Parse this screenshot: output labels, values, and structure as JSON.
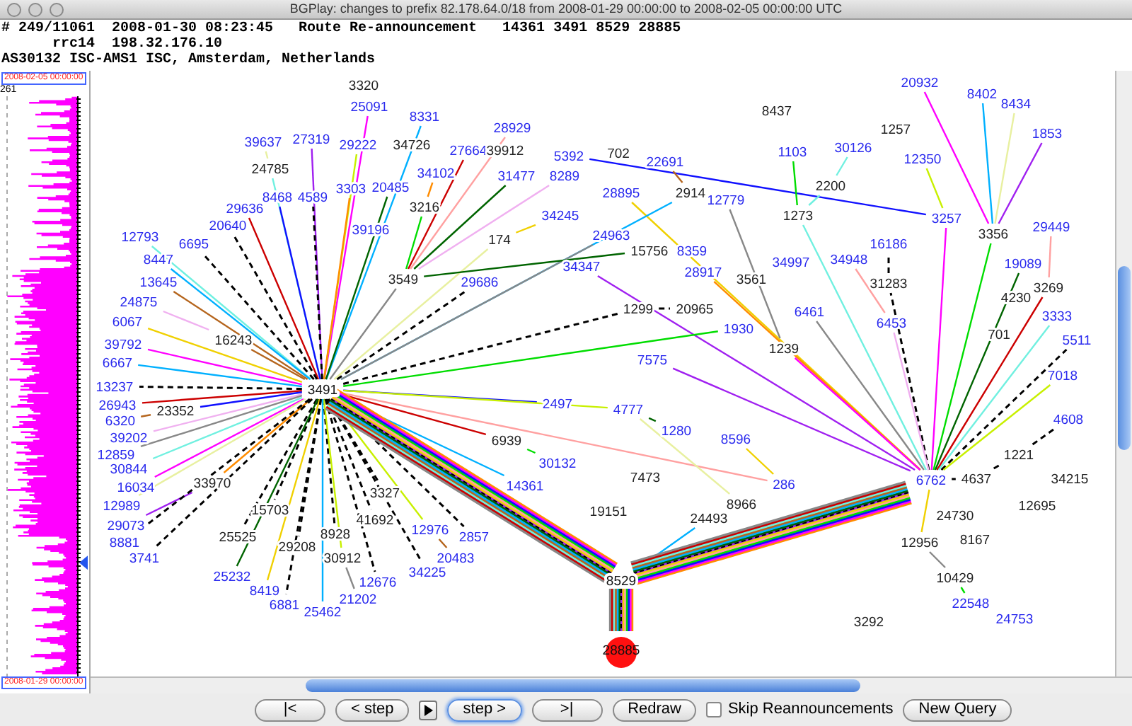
{
  "window": {
    "title": "BGPlay: changes to prefix 82.178.64.0/18 from 2008-01-29 00:00:00 to 2008-02-05 00:00:00 UTC"
  },
  "event": {
    "lines": [
      "# 249/11061  2008-01-30 08:23:45   Route Re-announcement   14361 3491 8529 28885",
      "      rrc14  198.32.176.10",
      "AS30132 ISC-AMS1 ISC, Amsterdam, Netherlands"
    ]
  },
  "timeline": {
    "end_label": "2008-02-05 00:00:00",
    "max_count": "261",
    "start_label": "2008-01-29 00:00:00",
    "cursor": {
      "level": 0.19
    }
  },
  "graph": {
    "nodes": [
      {
        "label": "3320",
        "kind": "transit"
      },
      {
        "label": "20932",
        "kind": "origin"
      },
      {
        "label": "8402",
        "kind": "origin"
      },
      {
        "label": "25091",
        "kind": "origin"
      },
      {
        "label": "8437",
        "kind": "transit"
      },
      {
        "label": "8434",
        "kind": "origin"
      },
      {
        "label": "8331",
        "kind": "origin"
      },
      {
        "label": "28929",
        "kind": "origin"
      },
      {
        "label": "1257",
        "kind": "transit"
      },
      {
        "label": "1853",
        "kind": "origin"
      },
      {
        "label": "39637",
        "kind": "origin"
      },
      {
        "label": "27319",
        "kind": "origin"
      },
      {
        "label": "29222",
        "kind": "origin"
      },
      {
        "label": "34726",
        "kind": "transit"
      },
      {
        "label": "27664",
        "kind": "origin"
      },
      {
        "label": "39912",
        "kind": "transit"
      },
      {
        "label": "5392",
        "kind": "origin"
      },
      {
        "label": "702",
        "kind": "transit"
      },
      {
        "label": "22691",
        "kind": "origin"
      },
      {
        "label": "1103",
        "kind": "origin"
      },
      {
        "label": "30126",
        "kind": "origin"
      },
      {
        "label": "12350",
        "kind": "origin"
      },
      {
        "label": "24785",
        "kind": "transit"
      },
      {
        "label": "34102",
        "kind": "origin"
      },
      {
        "label": "31477",
        "kind": "origin"
      },
      {
        "label": "8289",
        "kind": "origin"
      },
      {
        "label": "8468",
        "kind": "origin"
      },
      {
        "label": "4589",
        "kind": "origin"
      },
      {
        "label": "3303",
        "kind": "origin"
      },
      {
        "label": "20485",
        "kind": "origin"
      },
      {
        "label": "28895",
        "kind": "origin"
      },
      {
        "label": "2914",
        "kind": "transit"
      },
      {
        "label": "12779",
        "kind": "origin"
      },
      {
        "label": "2200",
        "kind": "transit"
      },
      {
        "label": "29636",
        "kind": "origin"
      },
      {
        "label": "3216",
        "kind": "transit"
      },
      {
        "label": "34245",
        "kind": "origin"
      },
      {
        "label": "1273",
        "kind": "transit"
      },
      {
        "label": "3257",
        "kind": "origin"
      },
      {
        "label": "12793",
        "kind": "origin"
      },
      {
        "label": "20640",
        "kind": "origin"
      },
      {
        "label": "39196",
        "kind": "origin"
      },
      {
        "label": "174",
        "kind": "transit"
      },
      {
        "label": "24963",
        "kind": "origin"
      },
      {
        "label": "3356",
        "kind": "transit"
      },
      {
        "label": "29449",
        "kind": "origin"
      },
      {
        "label": "6695",
        "kind": "origin"
      },
      {
        "label": "15756",
        "kind": "transit"
      },
      {
        "label": "8359",
        "kind": "origin"
      },
      {
        "label": "16186",
        "kind": "origin"
      },
      {
        "label": "8447",
        "kind": "origin"
      },
      {
        "label": "34347",
        "kind": "origin"
      },
      {
        "label": "34997",
        "kind": "origin"
      },
      {
        "label": "34948",
        "kind": "origin"
      },
      {
        "label": "19089",
        "kind": "origin"
      },
      {
        "label": "13645",
        "kind": "origin"
      },
      {
        "label": "3549",
        "kind": "transit"
      },
      {
        "label": "29686",
        "kind": "origin"
      },
      {
        "label": "28917",
        "kind": "origin"
      },
      {
        "label": "3561",
        "kind": "transit"
      },
      {
        "label": "31283",
        "kind": "transit"
      },
      {
        "label": "3269",
        "kind": "transit"
      },
      {
        "label": "24875",
        "kind": "origin"
      },
      {
        "label": "4230",
        "kind": "transit"
      },
      {
        "label": "6067",
        "kind": "origin"
      },
      {
        "label": "1299",
        "kind": "transit"
      },
      {
        "label": "20965",
        "kind": "transit"
      },
      {
        "label": "1930",
        "kind": "origin"
      },
      {
        "label": "6461",
        "kind": "origin"
      },
      {
        "label": "6453",
        "kind": "origin"
      },
      {
        "label": "701",
        "kind": "transit"
      },
      {
        "label": "3333",
        "kind": "origin"
      },
      {
        "label": "39792",
        "kind": "origin"
      },
      {
        "label": "16243",
        "kind": "transit"
      },
      {
        "label": "1239",
        "kind": "transit"
      },
      {
        "label": "5511",
        "kind": "origin"
      },
      {
        "label": "6667",
        "kind": "origin"
      },
      {
        "label": "7575",
        "kind": "origin"
      },
      {
        "label": "7018",
        "kind": "origin"
      },
      {
        "label": "13237",
        "kind": "origin"
      },
      {
        "label": "3491",
        "kind": "hub"
      },
      {
        "label": "26943",
        "kind": "origin"
      },
      {
        "label": "23352",
        "kind": "transit"
      },
      {
        "label": "2497",
        "kind": "origin"
      },
      {
        "label": "4777",
        "kind": "origin"
      },
      {
        "label": "6320",
        "kind": "origin"
      },
      {
        "label": "4608",
        "kind": "origin"
      },
      {
        "label": "39202",
        "kind": "origin"
      },
      {
        "label": "6939",
        "kind": "transit"
      },
      {
        "label": "1280",
        "kind": "origin"
      },
      {
        "label": "8596",
        "kind": "origin"
      },
      {
        "label": "12859",
        "kind": "origin"
      },
      {
        "label": "1221",
        "kind": "transit"
      },
      {
        "label": "30844",
        "kind": "origin"
      },
      {
        "label": "30132",
        "kind": "origin"
      },
      {
        "label": "16034",
        "kind": "origin"
      },
      {
        "label": "33970",
        "kind": "transit"
      },
      {
        "label": "3327",
        "kind": "transit"
      },
      {
        "label": "14361",
        "kind": "origin"
      },
      {
        "label": "7473",
        "kind": "transit"
      },
      {
        "label": "286",
        "kind": "origin"
      },
      {
        "label": "6762",
        "kind": "hub-origin"
      },
      {
        "label": "4637",
        "kind": "transit"
      },
      {
        "label": "34215",
        "kind": "transit"
      },
      {
        "label": "12989",
        "kind": "origin"
      },
      {
        "label": "15703",
        "kind": "transit"
      },
      {
        "label": "41692",
        "kind": "transit"
      },
      {
        "label": "19151",
        "kind": "transit"
      },
      {
        "label": "24493",
        "kind": "transit"
      },
      {
        "label": "8966",
        "kind": "transit"
      },
      {
        "label": "24730",
        "kind": "transit"
      },
      {
        "label": "12695",
        "kind": "transit"
      },
      {
        "label": "29073",
        "kind": "origin"
      },
      {
        "label": "8881",
        "kind": "origin"
      },
      {
        "label": "25525",
        "kind": "transit"
      },
      {
        "label": "29208",
        "kind": "transit"
      },
      {
        "label": "8928",
        "kind": "transit"
      },
      {
        "label": "12976",
        "kind": "origin"
      },
      {
        "label": "2857",
        "kind": "origin"
      },
      {
        "label": "12956",
        "kind": "transit"
      },
      {
        "label": "8167",
        "kind": "transit"
      },
      {
        "label": "3741",
        "kind": "origin"
      },
      {
        "label": "30912",
        "kind": "transit"
      },
      {
        "label": "20483",
        "kind": "origin"
      },
      {
        "label": "25232",
        "kind": "origin"
      },
      {
        "label": "12676",
        "kind": "origin"
      },
      {
        "label": "34225",
        "kind": "origin"
      },
      {
        "label": "8529",
        "kind": "hub"
      },
      {
        "label": "10429",
        "kind": "transit"
      },
      {
        "label": "8419",
        "kind": "origin"
      },
      {
        "label": "6881",
        "kind": "origin"
      },
      {
        "label": "21202",
        "kind": "origin"
      },
      {
        "label": "22548",
        "kind": "origin"
      },
      {
        "label": "25462",
        "kind": "origin"
      },
      {
        "label": "3292",
        "kind": "transit"
      },
      {
        "label": "24753",
        "kind": "origin"
      },
      {
        "label": "28885",
        "kind": "target"
      }
    ]
  },
  "controls": [
    {
      "kind": "button",
      "label": "|<",
      "focused": false
    },
    {
      "kind": "button",
      "label": "< step",
      "focused": false
    },
    {
      "kind": "play"
    },
    {
      "kind": "button",
      "label": "step >",
      "focused": true
    },
    {
      "kind": "button",
      "label": ">|",
      "focused": false
    },
    {
      "kind": "button",
      "label": "Redraw",
      "focused": false
    },
    {
      "kind": "checkbox",
      "label": "Skip Reannouncements",
      "checked": false
    },
    {
      "kind": "button",
      "label": "New Query",
      "focused": false
    }
  ]
}
